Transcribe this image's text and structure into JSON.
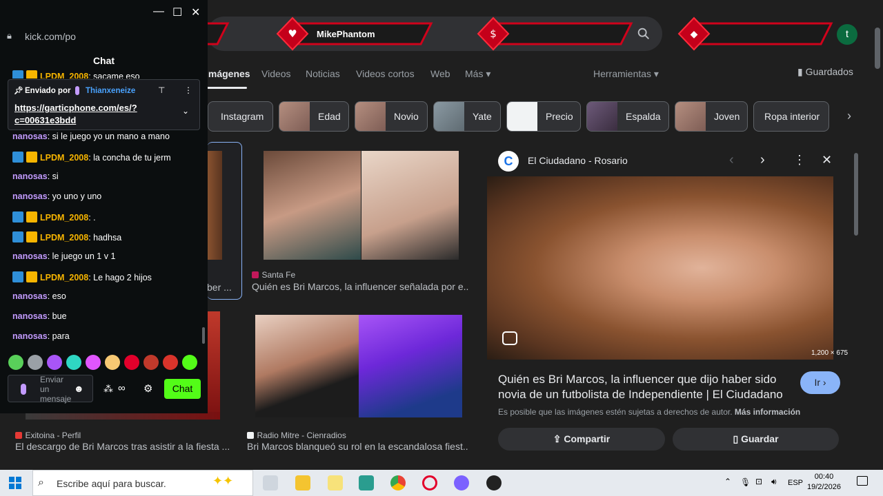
{
  "chat": {
    "url": "kick.com/po",
    "title": "Chat",
    "pinned": {
      "sent_by_label": "Enviado por",
      "sender": "Thianxeneize",
      "link_line1": "https://garticphone.com/es/?",
      "link_line2": "c=00631e3bdd"
    },
    "top_partial_message": {
      "user": "LPDM_2008",
      "text": ": sacame eso"
    },
    "messages": [
      {
        "user": "nanosas",
        "text": ": si le juego yo un mano a mano",
        "type": "n"
      },
      {
        "user": "LPDM_2008",
        "text": ": la concha de tu jerm",
        "type": "l"
      },
      {
        "user": "nanosas",
        "text": ": si",
        "type": "n"
      },
      {
        "user": "nanosas",
        "text": ": yo uno y uno",
        "type": "n"
      },
      {
        "user": "LPDM_2008",
        "text": ": .",
        "type": "l"
      },
      {
        "user": "LPDM_2008",
        "text": ": hadhsa",
        "type": "l"
      },
      {
        "user": "nanosas",
        "text": ": le juego un 1 v 1",
        "type": "n"
      },
      {
        "user": "LPDM_2008",
        "text": ": Le hago 2 hijos",
        "type": "l"
      },
      {
        "user": "nanosas",
        "text": ": eso",
        "type": "n"
      },
      {
        "user": "nanosas",
        "text": ": bue",
        "type": "n"
      },
      {
        "user": "nanosas",
        "text": ": para",
        "type": "n"
      }
    ],
    "input_placeholder_lines": [
      "Enviar",
      "un",
      "mensaje"
    ],
    "send_label": "Chat"
  },
  "banner": {
    "username": "MikePhantom",
    "avatar_letter": "t"
  },
  "google": {
    "tabs": [
      {
        "label": "Imágenes",
        "active": true
      },
      {
        "label": "Videos"
      },
      {
        "label": "Noticias"
      },
      {
        "label": "Videos cortos"
      },
      {
        "label": "Web"
      },
      {
        "label": "Más"
      }
    ],
    "tools_label": "Herramientas",
    "saved_label": "Guardados",
    "chips": [
      "Instagram",
      "Edad",
      "Novio",
      "Yate",
      "Precio",
      "Espalda",
      "Joven",
      "Ropa interior"
    ],
    "results": [
      {
        "source": "Santa Fe",
        "title": "Quién es Bri Marcos, la influencer señalada por e..."
      },
      {
        "source": "Exitoina - Perfil",
        "title": "El descargo de Bri Marcos tras asistir a la fiesta ..."
      },
      {
        "source": "Radio Mitre - Cienradios",
        "title": "Bri Marcos blanqueó su rol en la escandalosa fiest..."
      }
    ],
    "partial_caption": "ber ..."
  },
  "panel": {
    "source": "El Ciudadano - Rosario",
    "logo_letter": "C",
    "dimensions": "1,200 × 675",
    "title": "Quién es Bri Marcos, la influencer que dijo haber sido novia de un futbolista de Independiente | El Ciudadano",
    "visit_label": "Ir",
    "copyright": "Es posible que las imágenes estén sujetas a derechos de autor.",
    "more_info": "Más información",
    "share_label": "Compartir",
    "save_label": "Guardar"
  },
  "taskbar": {
    "search_placeholder": "Escribe aquí para buscar.",
    "language": "ESP",
    "time": "00:40",
    "date": "19/2/2026"
  }
}
